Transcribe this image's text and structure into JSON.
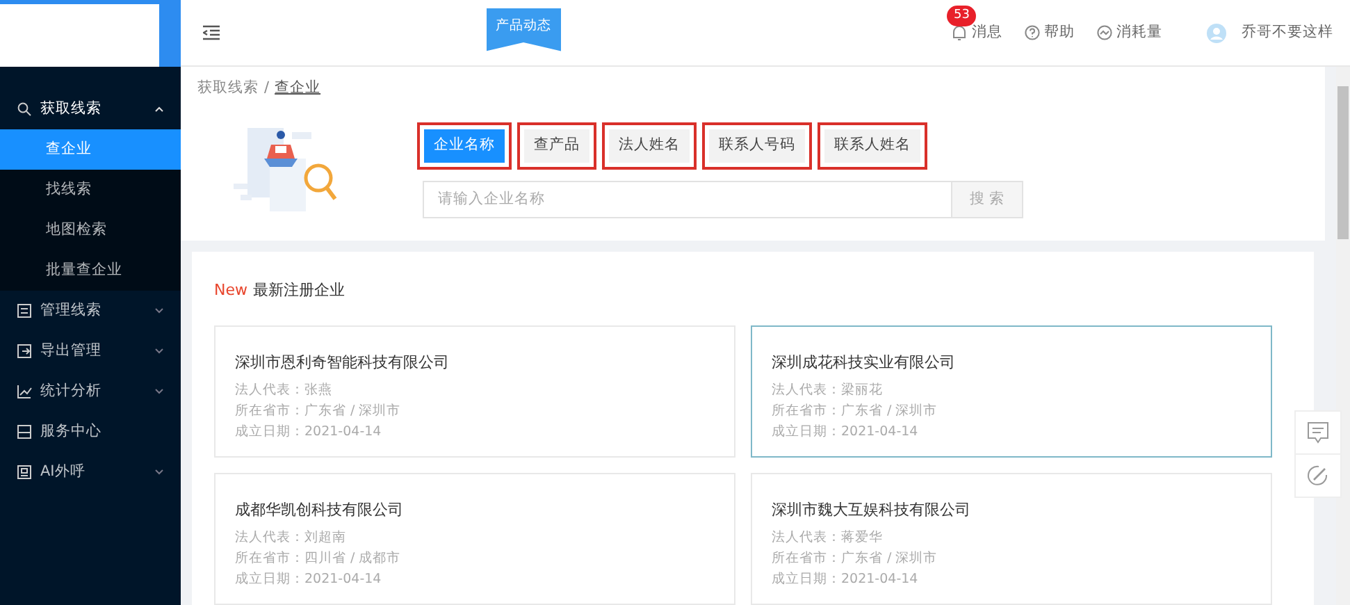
{
  "sidebar": {
    "items": [
      {
        "label": "获取线索",
        "kind": "group",
        "expanded": true,
        "children": [
          {
            "label": "查企业",
            "selected": true
          },
          {
            "label": "找线索",
            "selected": false
          },
          {
            "label": "地图检索",
            "selected": false
          },
          {
            "label": "批量查企业",
            "selected": false
          }
        ]
      },
      {
        "label": "管理线索",
        "kind": "group",
        "expanded": false
      },
      {
        "label": "导出管理",
        "kind": "group",
        "expanded": false
      },
      {
        "label": "统计分析",
        "kind": "group",
        "expanded": false
      },
      {
        "label": "服务中心",
        "kind": "link"
      },
      {
        "label": "AI外呼",
        "kind": "group",
        "expanded": false
      }
    ]
  },
  "header": {
    "banner": "产品动态",
    "notifications": {
      "count": "53",
      "label": "消息"
    },
    "help": "帮助",
    "usage": "消耗量",
    "user": {
      "name": "乔哥不要这样"
    }
  },
  "breadcrumb": {
    "items": [
      "获取线索",
      "查企业"
    ],
    "separator": "/"
  },
  "search": {
    "tabs": [
      {
        "label": "企业名称",
        "selected": true,
        "highlighted": true
      },
      {
        "label": "查产品",
        "selected": false,
        "highlighted": true
      },
      {
        "label": "法人姓名",
        "selected": false,
        "highlighted": true
      },
      {
        "label": "联系人号码",
        "selected": false,
        "highlighted": true
      },
      {
        "label": "联系人姓名",
        "selected": false,
        "highlighted": true
      }
    ],
    "placeholder": "请输入企业名称",
    "button": "搜 索"
  },
  "latest": {
    "tag": "New",
    "title": "最新注册企业",
    "companies": [
      {
        "name": "深圳市恩利奇智能科技有限公司",
        "representative": "法人代表：张燕",
        "region": "所在省市：广东省 / 深圳市",
        "founded": "成立日期：2021-04-14",
        "selected": false
      },
      {
        "name": "深圳成花科技实业有限公司",
        "representative": "法人代表：梁丽花",
        "region": "所在省市：广东省 / 深圳市",
        "founded": "成立日期：2021-04-14",
        "selected": true
      },
      {
        "name": "成都华凯创科技有限公司",
        "representative": "法人代表：刘超南",
        "region": "所在省市：四川省 / 成都市",
        "founded": "成立日期：2021-04-14",
        "selected": false
      },
      {
        "name": "深圳市魏大互娱科技有限公司",
        "representative": "法人代表：蒋爱华",
        "region": "所在省市：广东省 / 深圳市",
        "founded": "成立日期：2021-04-14",
        "selected": false
      }
    ]
  }
}
